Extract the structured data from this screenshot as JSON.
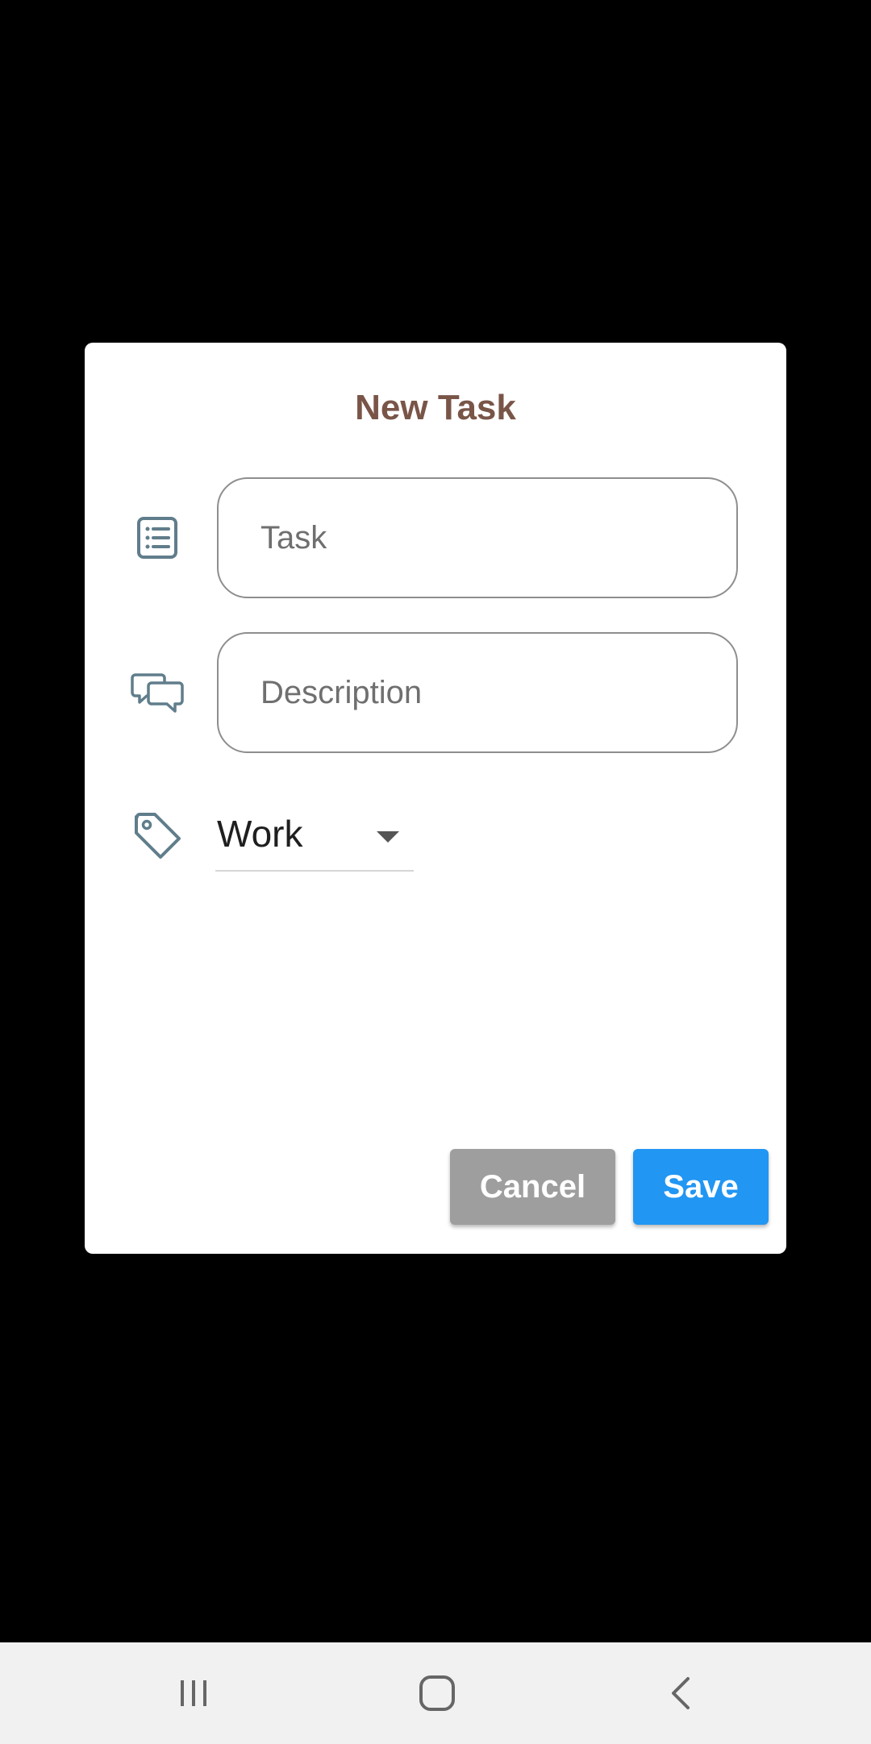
{
  "dialog": {
    "title": "New Task",
    "task_field": {
      "placeholder": "Task",
      "value": ""
    },
    "description_field": {
      "placeholder": "Description",
      "value": ""
    },
    "category_dropdown": {
      "selected": "Work"
    },
    "cancel_label": "Cancel",
    "save_label": "Save"
  },
  "icons": {
    "task": "list-icon",
    "description": "chat-bubbles-icon",
    "category": "tag-icon",
    "dropdown": "caret-down-icon"
  },
  "navbar": {
    "items": [
      "recent-apps",
      "home",
      "back"
    ]
  },
  "colors": {
    "title": "#795548",
    "icon": "#607d8b",
    "cancel_button": "#9e9e9e",
    "save_button": "#2196f3",
    "field_border": "#8e8e8e",
    "scrim": "#000000"
  }
}
